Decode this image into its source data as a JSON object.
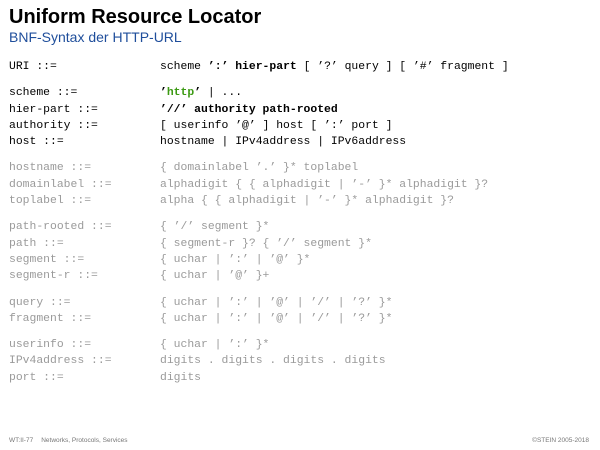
{
  "slide": {
    "title": "Uniform Resource Locator",
    "subtitle": "BNF-Syntax der HTTP-URL"
  },
  "rules": {
    "uri": {
      "lhs": "URI ::=",
      "rhs": [
        {
          "t": "scheme "
        },
        {
          "t": "’:’",
          "b": true
        },
        {
          "t": " "
        },
        {
          "t": "hier-part",
          "b": true
        },
        {
          "t": " [ ’?’ query ] [ ’#’ fragment ]"
        }
      ]
    },
    "main": [
      {
        "lhs": "scheme ::=",
        "rhs": [
          {
            "t": "’",
            "b": true
          },
          {
            "t": "http",
            "b": true,
            "green": true
          },
          {
            "t": "’",
            "b": true
          },
          {
            "t": " | ..."
          }
        ]
      },
      {
        "lhs": "hier-part ::=",
        "rhs": [
          {
            "t": "’//’ authority path-rooted",
            "b": true
          }
        ]
      },
      {
        "lhs": "authority ::=",
        "rhs": [
          {
            "t": "[ userinfo ’@’ ] host [ ’:’ port ]"
          }
        ]
      },
      {
        "lhs": "host ::=",
        "rhs": [
          {
            "t": "hostname | IPv4address | IPv6address"
          }
        ]
      }
    ],
    "hostname": [
      {
        "lhs": "hostname ::=",
        "rhs": "{ domainlabel ’.’ }* toplabel"
      },
      {
        "lhs": "domainlabel ::=",
        "rhs": "alphadigit { { alphadigit | ’-’ }* alphadigit }?"
      },
      {
        "lhs": "toplabel ::=",
        "rhs": "alpha { { alphadigit | ’-’ }* alphadigit }?"
      }
    ],
    "path": [
      {
        "lhs": "path-rooted ::=",
        "rhs": "{ ’/’ segment }*"
      },
      {
        "lhs": "path ::=",
        "rhs": "{ segment-r }? { ’/’ segment }*"
      },
      {
        "lhs": "segment ::=",
        "rhs": "{ uchar | ’:’ | ’@’ }*"
      },
      {
        "lhs": "segment-r ::=",
        "rhs": "{ uchar | ’@’ }+"
      }
    ],
    "query": [
      {
        "lhs": "query ::=",
        "rhs": "{ uchar | ’:’ | ’@’ | ’/’ | ’?’ }*"
      },
      {
        "lhs": "fragment ::=",
        "rhs": "{ uchar | ’:’ | ’@’ | ’/’ | ’?’ }*"
      }
    ],
    "misc": [
      {
        "lhs": "userinfo ::=",
        "rhs": "{ uchar | ’:’ }*"
      },
      {
        "lhs": "IPv4address ::=",
        "rhs": "digits . digits . digits . digits"
      },
      {
        "lhs": "port ::=",
        "rhs": "digits"
      }
    ]
  },
  "footer": {
    "code": "WT:II-77",
    "course": "Networks, Protocols, Services",
    "copyright": "©STEIN 2005-2018"
  },
  "colors": {
    "subtitle": "#1f4e9b",
    "http_keyword": "#3c9a13",
    "dimmed_rule": "#9a9a9a"
  }
}
